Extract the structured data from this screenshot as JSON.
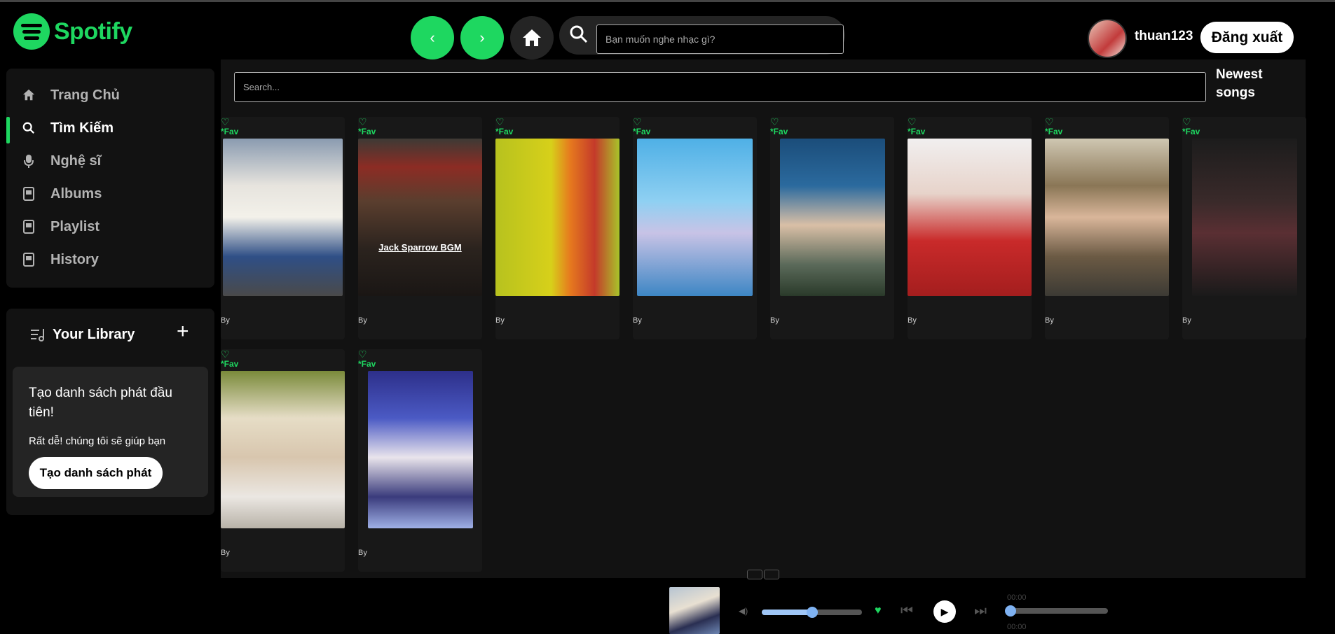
{
  "header": {
    "logo_text": "Spotify",
    "back_label": "‹",
    "forward_label": "›",
    "search_placeholder": "Bạn muốn nghe nhạc gì?",
    "username": "thuan123",
    "logout_label": "Đăng xuất"
  },
  "sidebar": {
    "items": [
      {
        "label": "Trang Chủ",
        "icon": "home-icon"
      },
      {
        "label": "Tìm Kiếm",
        "icon": "search-icon"
      },
      {
        "label": "Nghệ sĩ",
        "icon": "microphone-icon"
      },
      {
        "label": "Albums",
        "icon": "album-icon"
      },
      {
        "label": "Playlist",
        "icon": "playlist-icon"
      },
      {
        "label": "History",
        "icon": "history-icon"
      }
    ],
    "active_index": 1
  },
  "library": {
    "title": "Your Library",
    "plus_label": "+",
    "card_title": "Tạo danh sách phát đầu tiên!",
    "card_subtitle": "Rất dễ! chúng tôi sẽ giúp bạn",
    "card_button": "Tạo danh sách phát"
  },
  "main": {
    "search_placeholder": "Search...",
    "newest_label": "Newest songs",
    "songs": [
      {
        "fav": "*Fav",
        "by": "By",
        "cover_text": ""
      },
      {
        "fav": "*Fav",
        "by": "By",
        "cover_text": "Jack Sparrow BGM"
      },
      {
        "fav": "*Fav",
        "by": "By",
        "cover_text": ""
      },
      {
        "fav": "*Fav",
        "by": "By",
        "cover_text": ""
      },
      {
        "fav": "*Fav",
        "by": "By",
        "cover_text": ""
      },
      {
        "fav": "*Fav",
        "by": "By",
        "cover_text": ""
      },
      {
        "fav": "*Fav",
        "by": "By",
        "cover_text": ""
      },
      {
        "fav": "*Fav",
        "by": "By",
        "cover_text": ""
      },
      {
        "fav": "*Fav",
        "by": "By",
        "cover_text": ""
      },
      {
        "fav": "*Fav",
        "by": "By",
        "cover_text": ""
      }
    ]
  },
  "player": {
    "time_elapsed": "00:00",
    "time_total": "00:00",
    "volume_fraction": 0.5,
    "progress_fraction": 0.0
  },
  "colors": {
    "accent": "#1ed760",
    "background": "#000000",
    "panel": "#121212"
  }
}
